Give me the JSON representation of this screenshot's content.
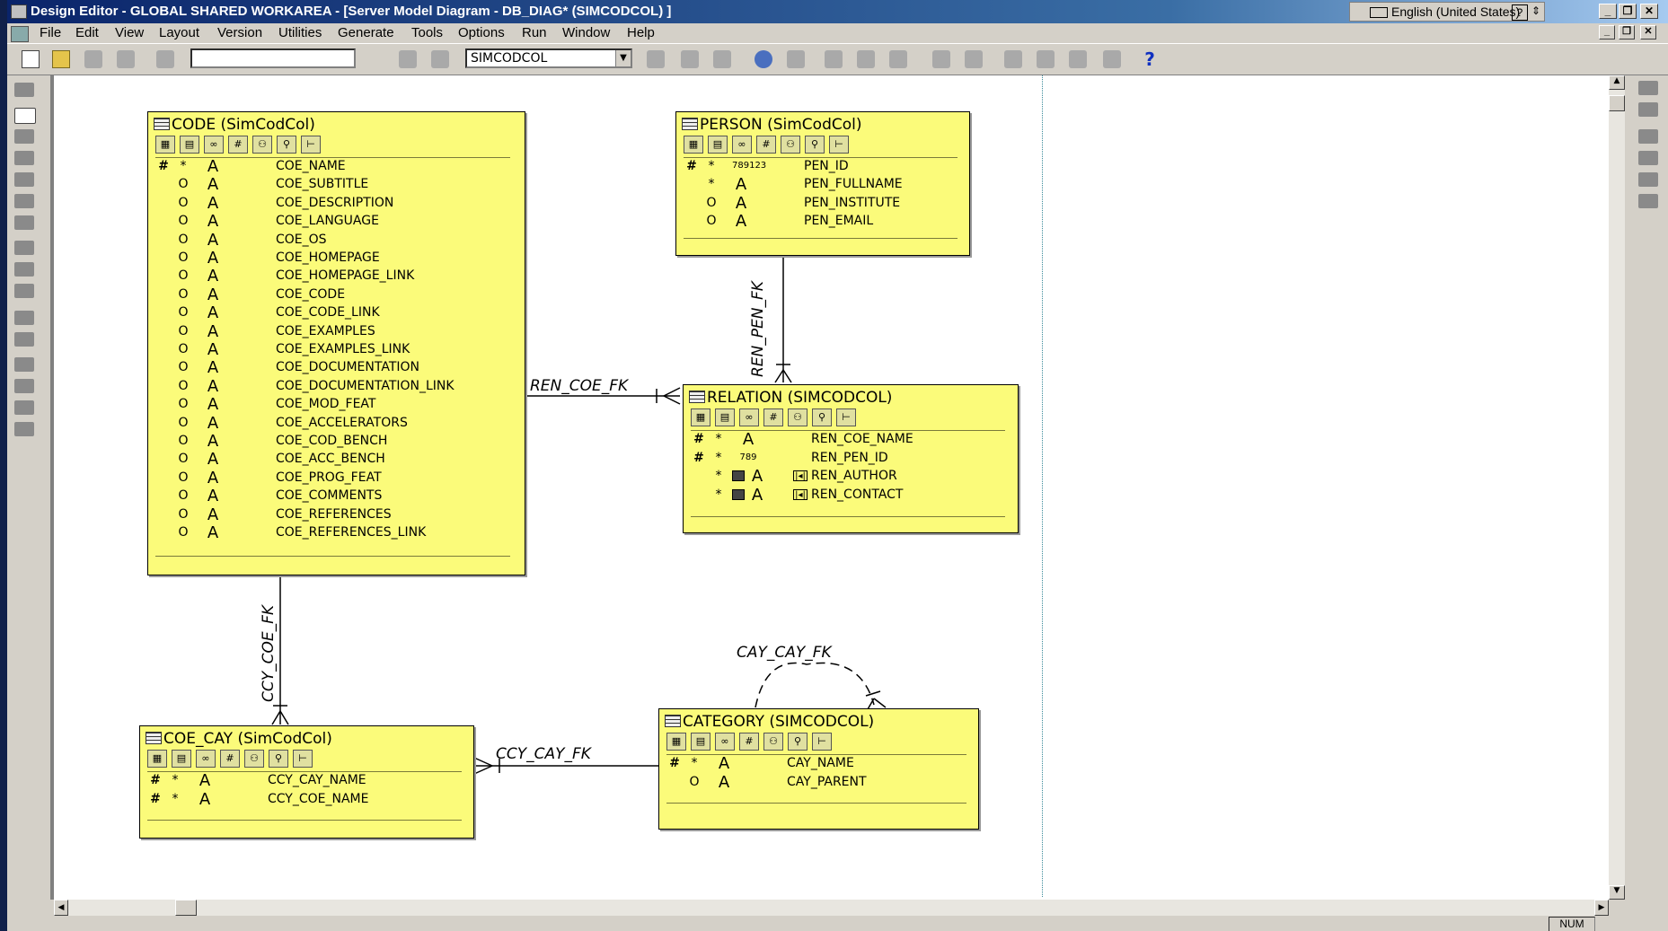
{
  "window": {
    "title": "Design Editor - GLOBAL SHARED WORKAREA - [Server Model Diagram - DB_DIAG* (SIMCODCOL) ]",
    "language": "English (United States)",
    "status_num": "NUM"
  },
  "menu": [
    "File",
    "Edit",
    "View",
    "Layout",
    "Version",
    "Utilities",
    "Generate",
    "Tools",
    "Options",
    "Run",
    "Window",
    "Help"
  ],
  "toolbar": {
    "search_value": "",
    "schema_select": "SIMCODCOL"
  },
  "relations": {
    "ren_coe_fk": "REN_COE_FK",
    "ren_pen_fk": "REN_PEN_FK",
    "ccy_coe_fk": "CCY_COE_FK",
    "ccy_cay_fk": "CCY_CAY_FK",
    "cay_cay_fk": "CAY_CAY_FK"
  },
  "entities": {
    "code": {
      "title": "CODE (SimCodCol)",
      "columns": [
        {
          "key": "#",
          "opt": "*",
          "type": "A",
          "name": "COE_NAME"
        },
        {
          "key": "",
          "opt": "O",
          "type": "A",
          "name": "COE_SUBTITLE"
        },
        {
          "key": "",
          "opt": "O",
          "type": "A",
          "name": "COE_DESCRIPTION"
        },
        {
          "key": "",
          "opt": "O",
          "type": "A",
          "name": "COE_LANGUAGE"
        },
        {
          "key": "",
          "opt": "O",
          "type": "A",
          "name": "COE_OS"
        },
        {
          "key": "",
          "opt": "O",
          "type": "A",
          "name": "COE_HOMEPAGE"
        },
        {
          "key": "",
          "opt": "O",
          "type": "A",
          "name": "COE_HOMEPAGE_LINK"
        },
        {
          "key": "",
          "opt": "O",
          "type": "A",
          "name": "COE_CODE"
        },
        {
          "key": "",
          "opt": "O",
          "type": "A",
          "name": "COE_CODE_LINK"
        },
        {
          "key": "",
          "opt": "O",
          "type": "A",
          "name": "COE_EXAMPLES"
        },
        {
          "key": "",
          "opt": "O",
          "type": "A",
          "name": "COE_EXAMPLES_LINK"
        },
        {
          "key": "",
          "opt": "O",
          "type": "A",
          "name": "COE_DOCUMENTATION"
        },
        {
          "key": "",
          "opt": "O",
          "type": "A",
          "name": "COE_DOCUMENTATION_LINK"
        },
        {
          "key": "",
          "opt": "O",
          "type": "A",
          "name": "COE_MOD_FEAT"
        },
        {
          "key": "",
          "opt": "O",
          "type": "A",
          "name": "COE_ACCELERATORS"
        },
        {
          "key": "",
          "opt": "O",
          "type": "A",
          "name": "COE_COD_BENCH"
        },
        {
          "key": "",
          "opt": "O",
          "type": "A",
          "name": "COE_ACC_BENCH"
        },
        {
          "key": "",
          "opt": "O",
          "type": "A",
          "name": "COE_PROG_FEAT"
        },
        {
          "key": "",
          "opt": "O",
          "type": "A",
          "name": "COE_COMMENTS"
        },
        {
          "key": "",
          "opt": "O",
          "type": "A",
          "name": "COE_REFERENCES"
        },
        {
          "key": "",
          "opt": "O",
          "type": "A",
          "name": "COE_REFERENCES_LINK"
        }
      ]
    },
    "person": {
      "title": "PERSON (SimCodCol)",
      "columns": [
        {
          "key": "#",
          "opt": "*",
          "type": "789123",
          "name": "PEN_ID"
        },
        {
          "key": "",
          "opt": "*",
          "type": "A",
          "name": "PEN_FULLNAME"
        },
        {
          "key": "",
          "opt": "O",
          "type": "A",
          "name": "PEN_INSTITUTE"
        },
        {
          "key": "",
          "opt": "O",
          "type": "A",
          "name": "PEN_EMAIL"
        }
      ]
    },
    "relation": {
      "title": "RELATION (SIMCODCOL)",
      "columns": [
        {
          "key": "#",
          "opt": "*",
          "type": "A",
          "name": "REN_COE_NAME"
        },
        {
          "key": "#",
          "opt": "*",
          "type": "789",
          "name": "REN_PEN_ID"
        },
        {
          "key": "",
          "opt": "*",
          "type": "A",
          "name": "REN_AUTHOR"
        },
        {
          "key": "",
          "opt": "*",
          "type": "A",
          "name": "REN_CONTACT"
        }
      ]
    },
    "coe_cay": {
      "title": "COE_CAY (SimCodCol)",
      "columns": [
        {
          "key": "#",
          "opt": "*",
          "type": "A",
          "name": "CCY_CAY_NAME"
        },
        {
          "key": "#",
          "opt": "*",
          "type": "A",
          "name": "CCY_COE_NAME"
        }
      ]
    },
    "category": {
      "title": "CATEGORY (SIMCODCOL)",
      "columns": [
        {
          "key": "#",
          "opt": "*",
          "type": "A",
          "name": "CAY_NAME"
        },
        {
          "key": "",
          "opt": "O",
          "type": "A",
          "name": "CAY_PARENT"
        }
      ]
    }
  }
}
